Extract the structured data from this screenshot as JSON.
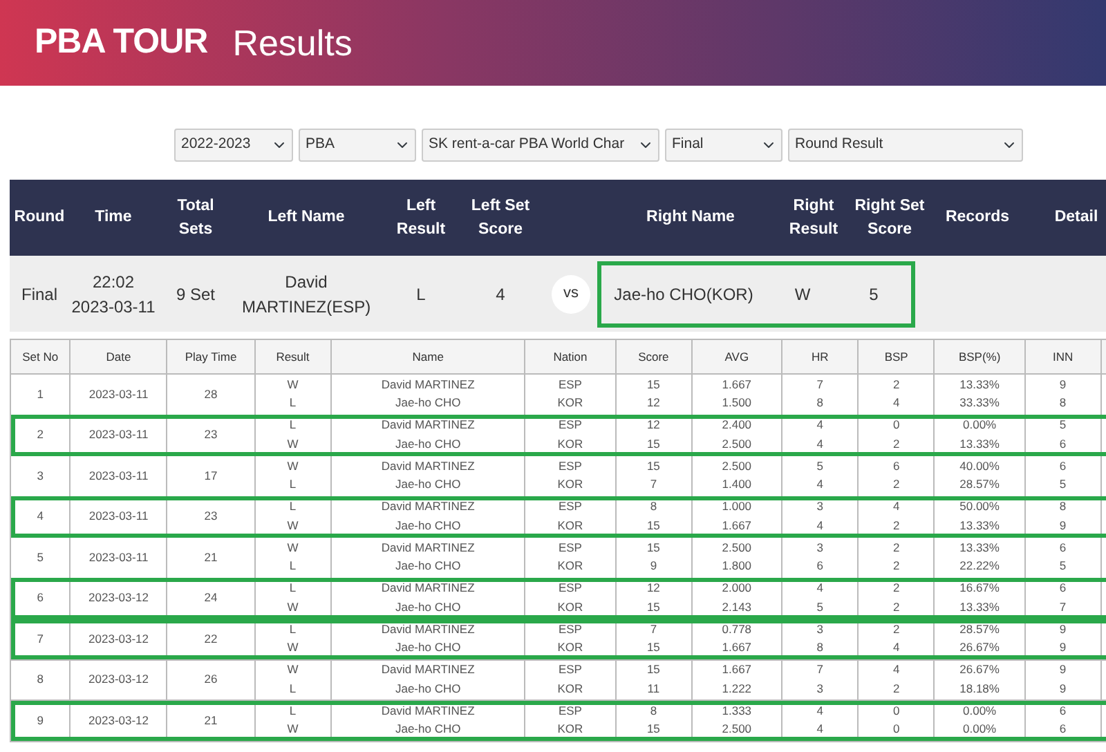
{
  "header": {
    "logo": "PBA TOUR",
    "title": "Results"
  },
  "filters": [
    {
      "value": "2022-2023"
    },
    {
      "value": "PBA"
    },
    {
      "value": "SK rent-a-car PBA World Char"
    },
    {
      "value": "Final"
    },
    {
      "value": "Round Result"
    }
  ],
  "match_table": {
    "columns": [
      "Round",
      "Time",
      "Total Sets",
      "Left Name",
      "Left Result",
      "Left Set Score",
      "",
      "Right Name",
      "Right Result",
      "Right Set Score",
      "Records",
      "Detail"
    ],
    "row": {
      "round": "Final",
      "time": "22:02",
      "date": "2023-03-11",
      "total_sets": "9 Set",
      "left_name": "David MARTINEZ(ESP)",
      "left_result": "L",
      "left_set_score": "4",
      "vs": "vs",
      "right_name": "Jae-ho CHO(KOR)",
      "right_result": "W",
      "right_set_score": "5",
      "right_highlighted": true
    }
  },
  "sets_table": {
    "columns": [
      "Set No",
      "Date",
      "Play Time",
      "Result",
      "Name",
      "Nation",
      "Score",
      "AVG",
      "HR",
      "BSP",
      "BSP(%)",
      "INN"
    ],
    "rows": [
      {
        "set_no": "1",
        "date": "2023-03-11",
        "play_time": "28",
        "highlighted": false,
        "players": [
          {
            "result": "W",
            "name": "David MARTINEZ",
            "nation": "ESP",
            "score": "15",
            "avg": "1.667",
            "hr": "7",
            "bsp": "2",
            "bsp_pct": "13.33%",
            "inn": "9"
          },
          {
            "result": "L",
            "name": "Jae-ho CHO",
            "nation": "KOR",
            "score": "12",
            "avg": "1.500",
            "hr": "8",
            "bsp": "4",
            "bsp_pct": "33.33%",
            "inn": "8"
          }
        ]
      },
      {
        "set_no": "2",
        "date": "2023-03-11",
        "play_time": "23",
        "highlighted": true,
        "players": [
          {
            "result": "L",
            "name": "David MARTINEZ",
            "nation": "ESP",
            "score": "12",
            "avg": "2.400",
            "hr": "4",
            "bsp": "0",
            "bsp_pct": "0.00%",
            "inn": "5"
          },
          {
            "result": "W",
            "name": "Jae-ho CHO",
            "nation": "KOR",
            "score": "15",
            "avg": "2.500",
            "hr": "4",
            "bsp": "2",
            "bsp_pct": "13.33%",
            "inn": "6"
          }
        ]
      },
      {
        "set_no": "3",
        "date": "2023-03-11",
        "play_time": "17",
        "highlighted": false,
        "players": [
          {
            "result": "W",
            "name": "David MARTINEZ",
            "nation": "ESP",
            "score": "15",
            "avg": "2.500",
            "hr": "5",
            "bsp": "6",
            "bsp_pct": "40.00%",
            "inn": "6"
          },
          {
            "result": "L",
            "name": "Jae-ho CHO",
            "nation": "KOR",
            "score": "7",
            "avg": "1.400",
            "hr": "4",
            "bsp": "2",
            "bsp_pct": "28.57%",
            "inn": "5"
          }
        ]
      },
      {
        "set_no": "4",
        "date": "2023-03-11",
        "play_time": "23",
        "highlighted": true,
        "players": [
          {
            "result": "L",
            "name": "David MARTINEZ",
            "nation": "ESP",
            "score": "8",
            "avg": "1.000",
            "hr": "3",
            "bsp": "4",
            "bsp_pct": "50.00%",
            "inn": "8"
          },
          {
            "result": "W",
            "name": "Jae-ho CHO",
            "nation": "KOR",
            "score": "15",
            "avg": "1.667",
            "hr": "4",
            "bsp": "2",
            "bsp_pct": "13.33%",
            "inn": "9"
          }
        ]
      },
      {
        "set_no": "5",
        "date": "2023-03-11",
        "play_time": "21",
        "highlighted": false,
        "players": [
          {
            "result": "W",
            "name": "David MARTINEZ",
            "nation": "ESP",
            "score": "15",
            "avg": "2.500",
            "hr": "3",
            "bsp": "2",
            "bsp_pct": "13.33%",
            "inn": "6"
          },
          {
            "result": "L",
            "name": "Jae-ho CHO",
            "nation": "KOR",
            "score": "9",
            "avg": "1.800",
            "hr": "6",
            "bsp": "2",
            "bsp_pct": "22.22%",
            "inn": "5"
          }
        ]
      },
      {
        "set_no": "6",
        "date": "2023-03-12",
        "play_time": "24",
        "highlighted": true,
        "players": [
          {
            "result": "L",
            "name": "David MARTINEZ",
            "nation": "ESP",
            "score": "12",
            "avg": "2.000",
            "hr": "4",
            "bsp": "2",
            "bsp_pct": "16.67%",
            "inn": "6"
          },
          {
            "result": "W",
            "name": "Jae-ho CHO",
            "nation": "KOR",
            "score": "15",
            "avg": "2.143",
            "hr": "5",
            "bsp": "2",
            "bsp_pct": "13.33%",
            "inn": "7"
          }
        ]
      },
      {
        "set_no": "7",
        "date": "2023-03-12",
        "play_time": "22",
        "highlighted": true,
        "players": [
          {
            "result": "L",
            "name": "David MARTINEZ",
            "nation": "ESP",
            "score": "7",
            "avg": "0.778",
            "hr": "3",
            "bsp": "2",
            "bsp_pct": "28.57%",
            "inn": "9"
          },
          {
            "result": "W",
            "name": "Jae-ho CHO",
            "nation": "KOR",
            "score": "15",
            "avg": "1.667",
            "hr": "8",
            "bsp": "4",
            "bsp_pct": "26.67%",
            "inn": "9"
          }
        ]
      },
      {
        "set_no": "8",
        "date": "2023-03-12",
        "play_time": "26",
        "highlighted": false,
        "players": [
          {
            "result": "W",
            "name": "David MARTINEZ",
            "nation": "ESP",
            "score": "15",
            "avg": "1.667",
            "hr": "7",
            "bsp": "4",
            "bsp_pct": "26.67%",
            "inn": "9"
          },
          {
            "result": "L",
            "name": "Jae-ho CHO",
            "nation": "KOR",
            "score": "11",
            "avg": "1.222",
            "hr": "3",
            "bsp": "2",
            "bsp_pct": "18.18%",
            "inn": "9"
          }
        ]
      },
      {
        "set_no": "9",
        "date": "2023-03-12",
        "play_time": "21",
        "highlighted": true,
        "players": [
          {
            "result": "L",
            "name": "David MARTINEZ",
            "nation": "ESP",
            "score": "8",
            "avg": "1.333",
            "hr": "4",
            "bsp": "0",
            "bsp_pct": "0.00%",
            "inn": "6"
          },
          {
            "result": "W",
            "name": "Jae-ho CHO",
            "nation": "KOR",
            "score": "15",
            "avg": "2.500",
            "hr": "4",
            "bsp": "0",
            "bsp_pct": "0.00%",
            "inn": "6"
          }
        ]
      }
    ]
  }
}
